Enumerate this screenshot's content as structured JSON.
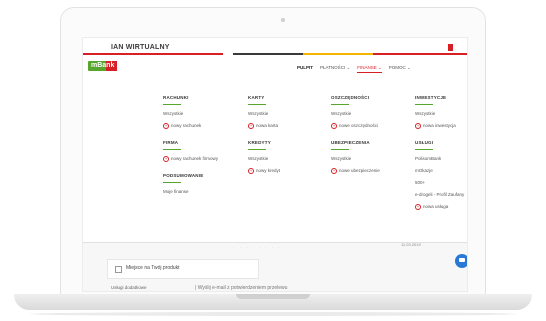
{
  "header": {
    "username": "IAN WIRTUALNY",
    "logo_text": "mBank",
    "stripe_colors": [
      "#d81f26",
      "#58a52d",
      "#3a3a3a",
      "#f2b500",
      "#d81f26"
    ]
  },
  "nav": {
    "items": [
      {
        "label": "PULPIT",
        "state": "active"
      },
      {
        "label": "PŁATNOŚCI ⌄",
        "state": "normal"
      },
      {
        "label": "FINANSE ⌄",
        "state": "current"
      },
      {
        "label": "POMOC ⌄",
        "state": "normal"
      }
    ]
  },
  "menu": {
    "rachunki": {
      "title": "RACHUNKI",
      "all": "Wszystkie",
      "add": "nowy rachunek"
    },
    "karty": {
      "title": "KARTY",
      "all": "Wszystkie",
      "add": "nowa karta"
    },
    "oszczednosci": {
      "title": "OSZCZĘDNOŚCI",
      "all": "Wszystkie",
      "add": "nowe oszczędności"
    },
    "inwestycje": {
      "title": "INWESTYCJE",
      "all": "Wszystkie",
      "add": "nowa inwestycja"
    },
    "firma": {
      "title": "FIRMA",
      "add": "nowy rachunek firmowy"
    },
    "kredyty": {
      "title": "KREDYTY",
      "all": "Wszystkie",
      "add": "nowy kredyt"
    },
    "ubezpieczenia": {
      "title": "UBEZPIECZENIA",
      "all": "Wszystkie",
      "add": "nowe ubezpieczenie"
    },
    "uslugi": {
      "title": "USŁUGI",
      "items": [
        "PolisomBank",
        "mOkazje",
        "500+",
        "e-drogeli - Profil Zaufany"
      ],
      "add": "nowa usługa"
    },
    "podsumowanie": {
      "title": "PODSUMOWANIE",
      "link": "Moje finanse"
    }
  },
  "below": {
    "card_label": "Miejsce na Twój produkt",
    "side_label": "Usługi dodatkowe",
    "mid_text": "| Wyślij e-mail z potwierdzeniem przelewu",
    "date": "11.03.2019"
  }
}
